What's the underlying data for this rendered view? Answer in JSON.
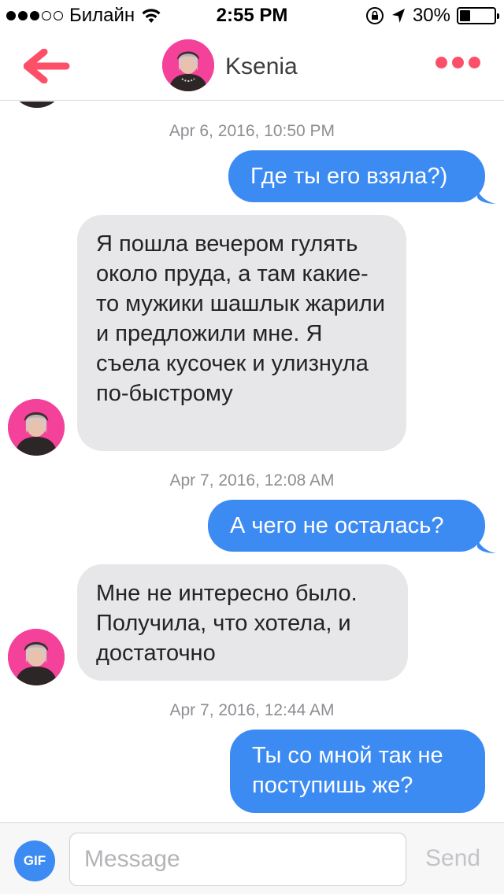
{
  "status_bar": {
    "carrier": "Билайн",
    "time": "2:55 PM",
    "battery": "30%",
    "battery_level": 0.3,
    "signal_bars_filled": 3,
    "signal_bars_total": 5
  },
  "header": {
    "contact_name": "Ksenia",
    "back_icon": "back-arrow-icon",
    "more_icon": "more-dots-icon",
    "accent_color": "#fd5068"
  },
  "conversation": {
    "timestamps": [
      "Apr 6, 2016, 10:50 PM",
      "Apr 7, 2016, 12:08 AM",
      "Apr 7, 2016, 12:44 AM"
    ],
    "messages": [
      {
        "from": "me",
        "text": "Где ты его взяла?)"
      },
      {
        "from": "Ksenia",
        "text": "Я пошла вечером гулять около пруда, а там какие-то мужики шашлык жарили и предложили мне. Я съела кусочек и улизнула по-быстрому"
      },
      {
        "from": "me",
        "text": "А чего не осталась?"
      },
      {
        "from": "Ksenia",
        "text": "Мне не интересно было. Получила, что хотела, и достаточно"
      },
      {
        "from": "me",
        "text": "Ты со мной так не поступишь же?"
      }
    ],
    "outgoing_color": "#3c8bf3",
    "incoming_color": "#e7e7ea"
  },
  "composer": {
    "gif_label": "GIF",
    "placeholder": "Message",
    "value": "",
    "send_label": "Send"
  }
}
